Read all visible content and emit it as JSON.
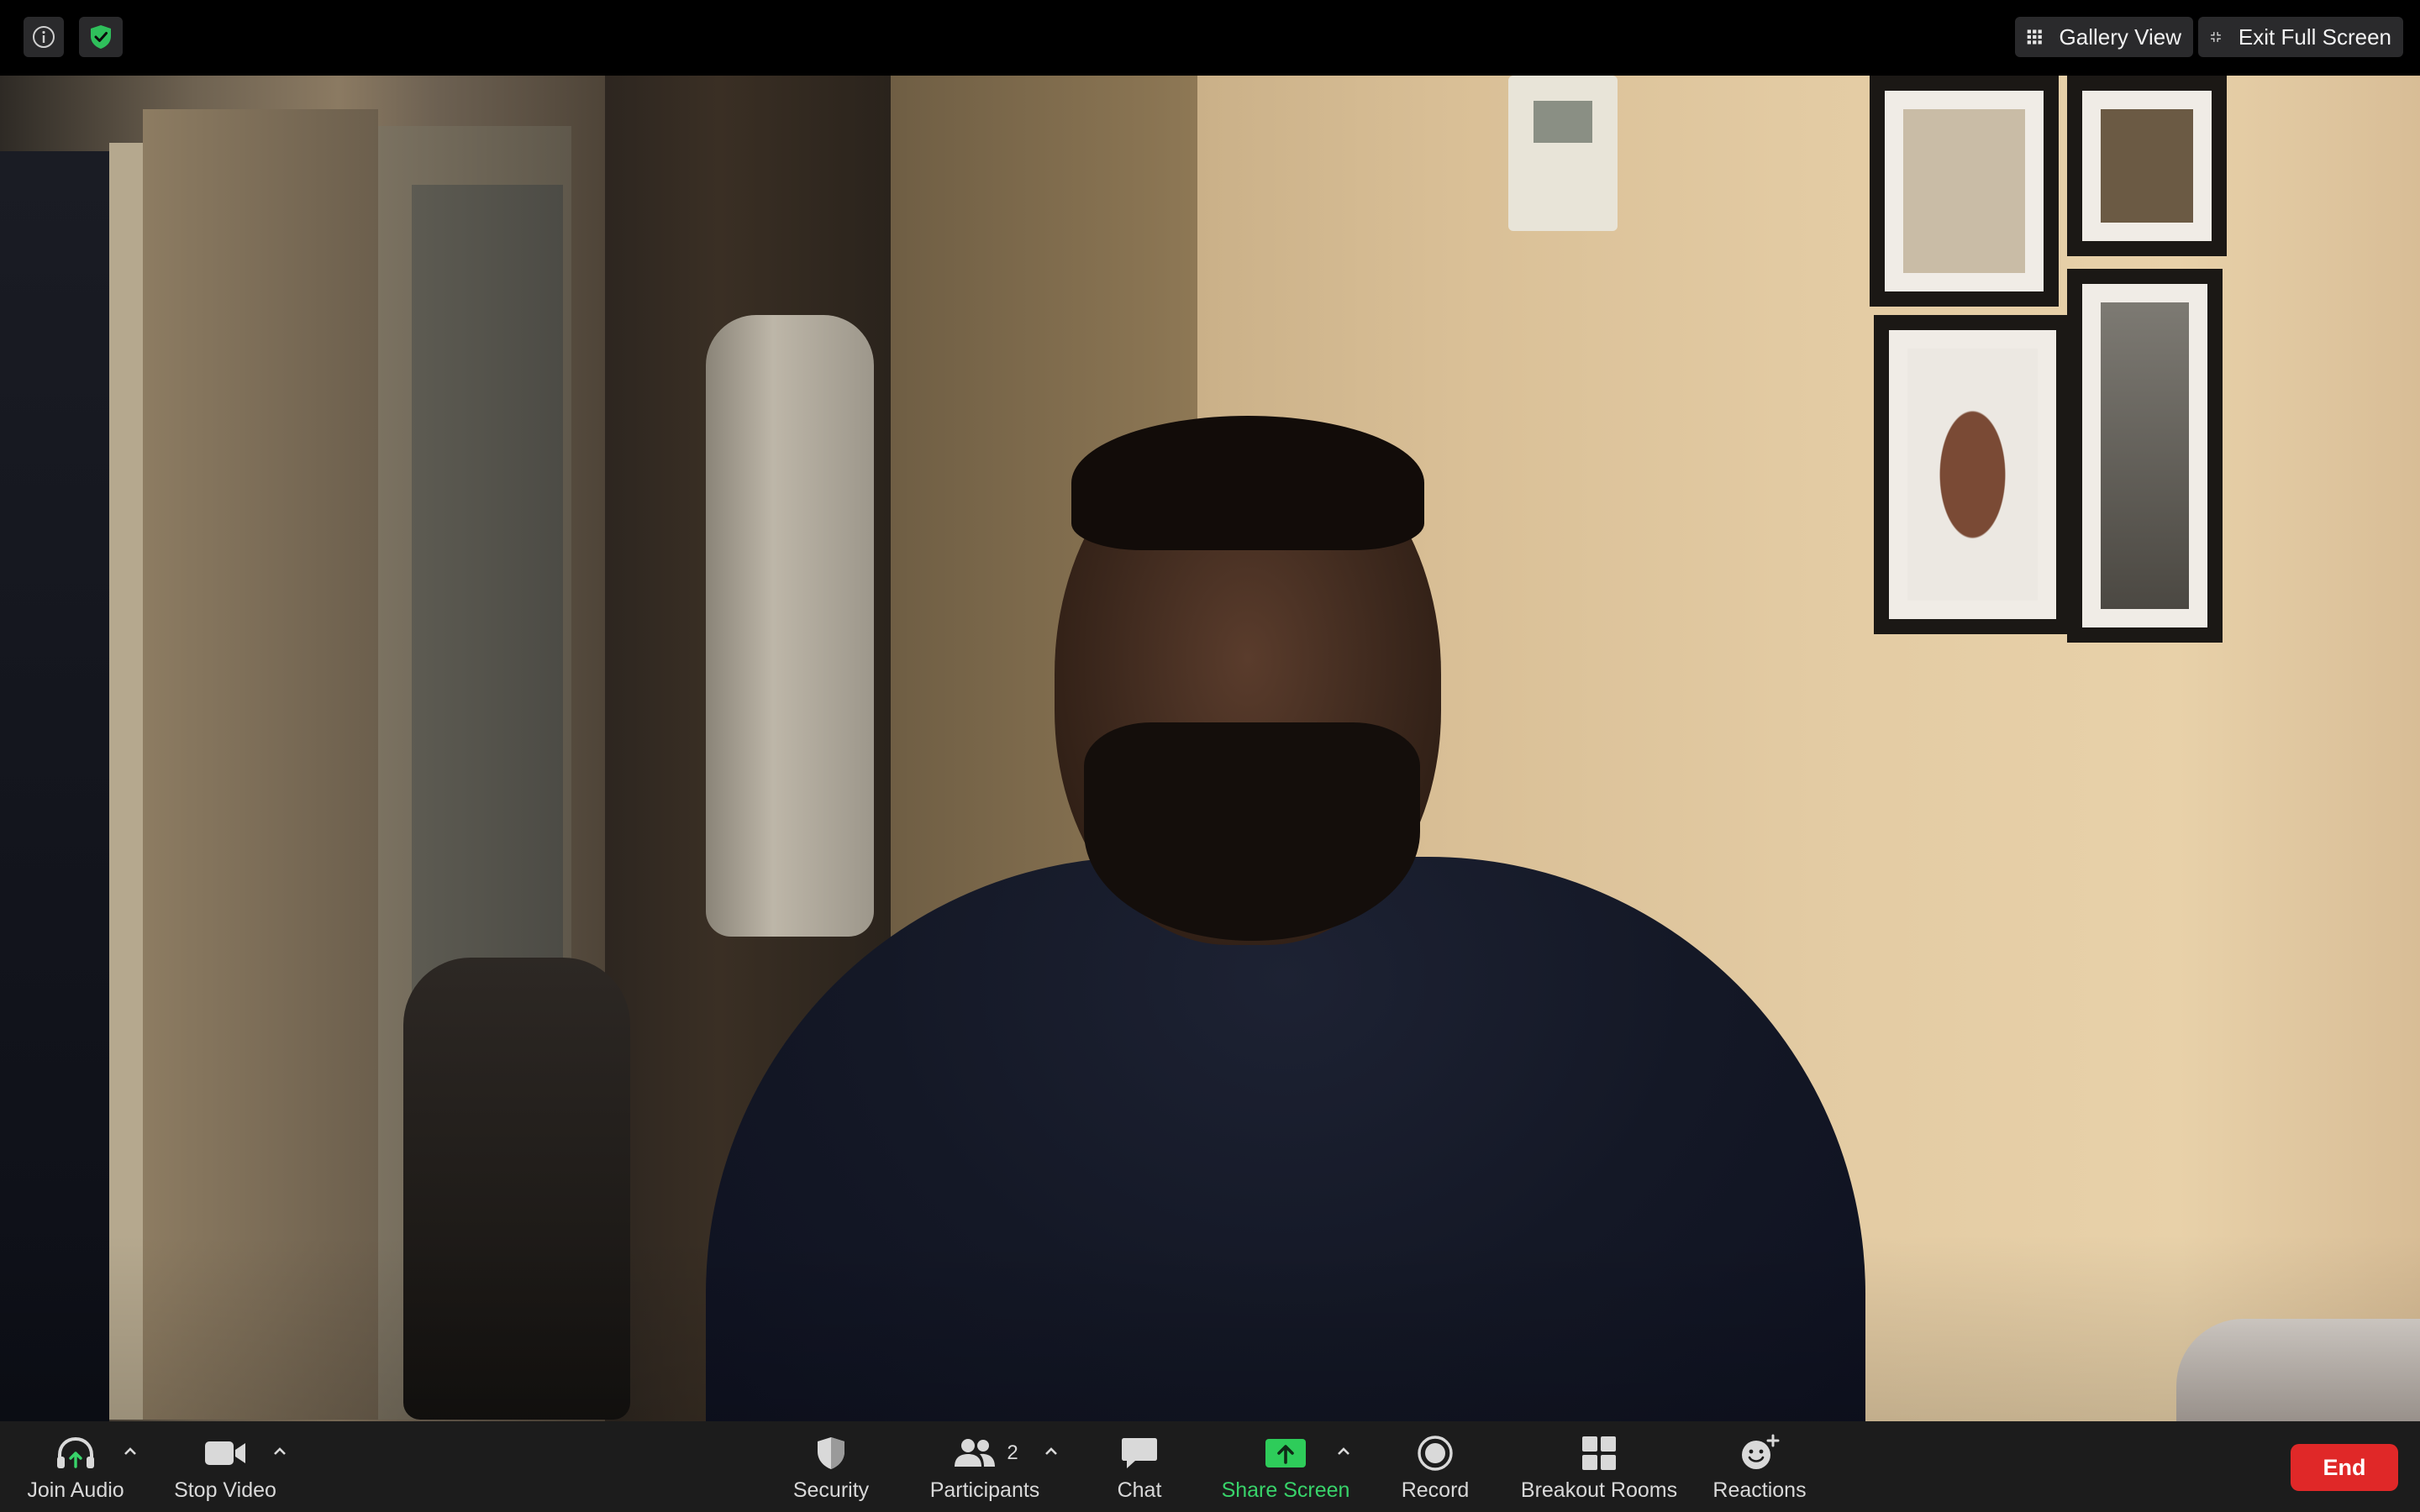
{
  "top_bar": {
    "info_icon": "info-icon",
    "encryption_icon": "shield-check-icon",
    "gallery_view_label": "Gallery View",
    "exit_full_screen_label": "Exit Full Screen"
  },
  "video": {
    "description_icon": "participant-video"
  },
  "toolbar": {
    "join_audio": "Join Audio",
    "stop_video": "Stop Video",
    "security": "Security",
    "participants": "Participants",
    "participants_count": "2",
    "chat": "Chat",
    "share_screen": "Share Screen",
    "record": "Record",
    "breakout_rooms": "Breakout Rooms",
    "reactions": "Reactions",
    "end": "End"
  },
  "colors": {
    "toolbar_bg": "#1c1c1c",
    "share_green": "#38d36a",
    "end_red": "#e02828",
    "shield_green": "#2fbf5b"
  }
}
